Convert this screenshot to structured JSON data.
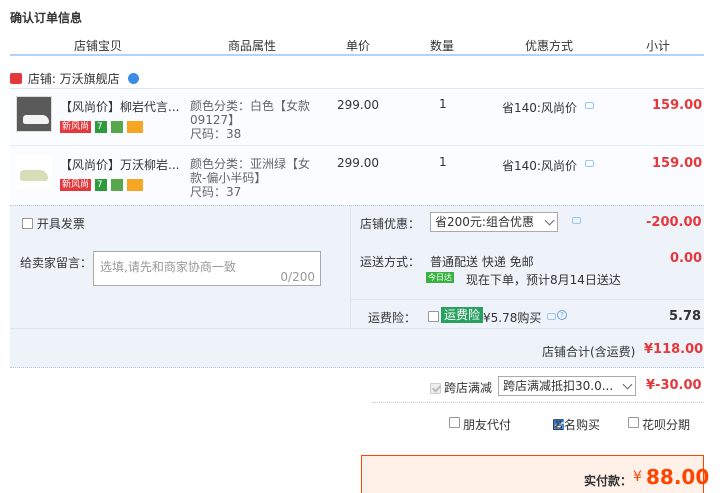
{
  "page": {
    "title": "确认订单信息"
  },
  "columns": [
    "店铺宝贝",
    "商品属性",
    "单价",
    "数量",
    "优惠方式",
    "小计"
  ],
  "shop": {
    "label": "店铺: 万沃旗舰店"
  },
  "items": [
    {
      "name": "【风尚价】柳岩代言...",
      "attr_line1": "颜色分类：白色【女款",
      "attr_line2": "09127】",
      "attr_line3": "尺码：38",
      "price": "299.00",
      "qty": "1",
      "promo": "省140:风尚价",
      "subtotal": "159.00",
      "badge": "新风尚"
    },
    {
      "name": "【风尚价】万沃柳岩...",
      "attr_line1": "颜色分类：亚洲绿【女",
      "attr_line2": "款-偏小半码】",
      "attr_line3": "尺码：37",
      "price": "299.00",
      "qty": "1",
      "promo": "省140:风尚价",
      "subtotal": "159.00",
      "badge": "新风尚"
    }
  ],
  "invoice": {
    "label": "开具发票"
  },
  "shop_discount": {
    "label": "店铺优惠：",
    "selected": "省200元:组合优惠",
    "amount": "-200.00"
  },
  "message": {
    "label": "给卖家留言：",
    "placeholder": "选填,请先和商家协商一致",
    "counter": "0/200"
  },
  "shipping": {
    "label": "运送方式：",
    "method": "普通配送 快递 免邮",
    "today_badge": "今日达",
    "eta": "现在下单，预计8月14日送达",
    "amount": "0.00"
  },
  "insurance": {
    "label": "运费险：",
    "tag": "运费险",
    "price": "¥5.78购买",
    "amount": "5.78"
  },
  "shop_total": {
    "label": "店铺合计(含运费)",
    "amount": "¥118.00"
  },
  "cross_store": {
    "label": "跨店满减",
    "selected": "跨店满减抵扣30.0...",
    "amount": "¥-30.00"
  },
  "options": {
    "friend_pay": "朋友代付",
    "anonymous": "匿名购买",
    "huabei": "花呗分期"
  },
  "payment": {
    "label": "实付款：",
    "currency": "¥",
    "amount": "88.00"
  },
  "colors": {
    "accent": "#f40",
    "header_bg": "#eef3fa",
    "badge_red": "#e4393c"
  }
}
